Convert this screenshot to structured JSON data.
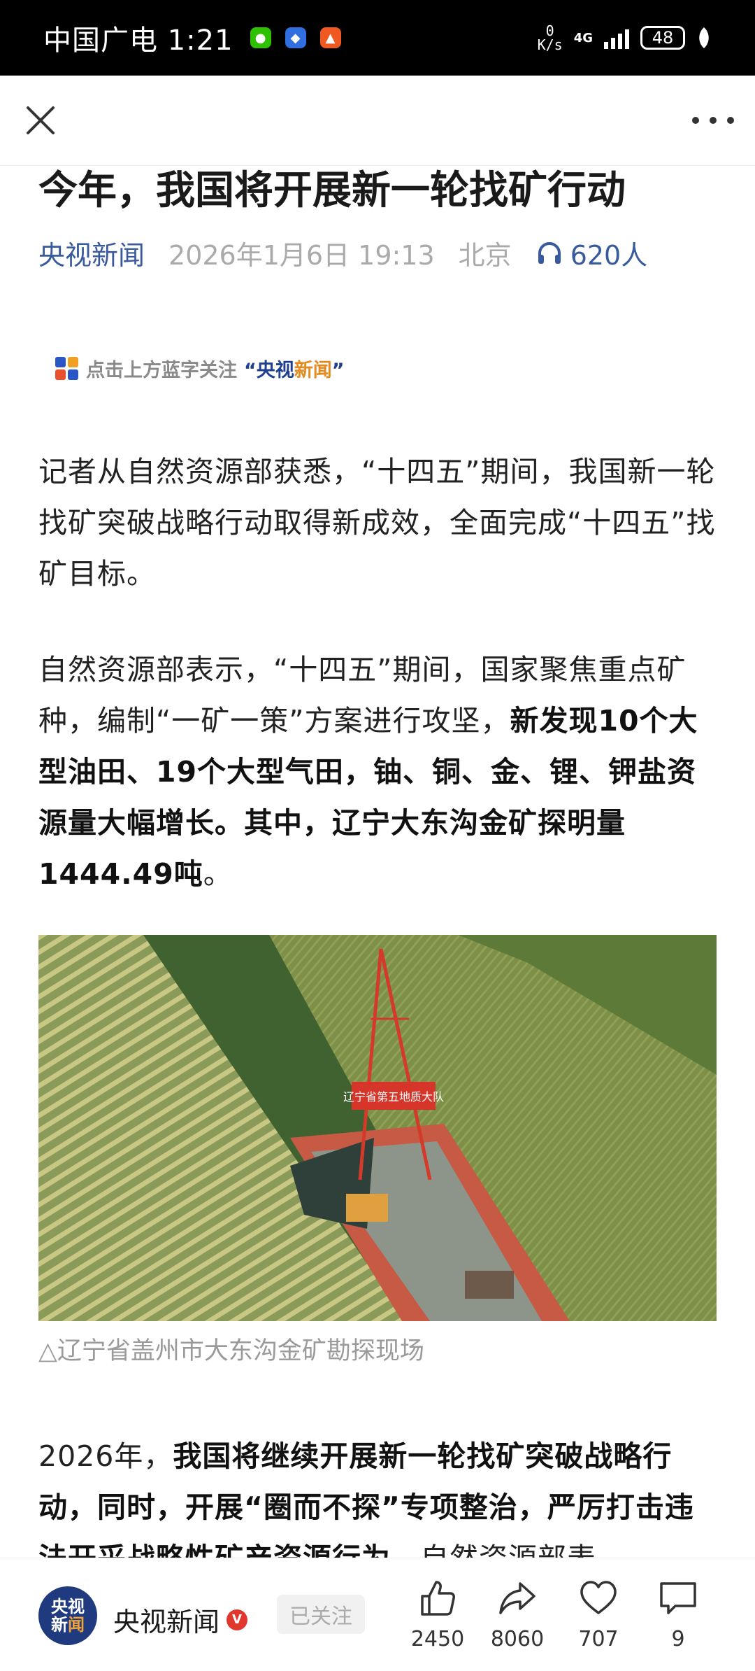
{
  "status_bar": {
    "carrier_time": "中国广电 1:21",
    "net_speed_value": "0",
    "net_speed_unit": "K/s",
    "network": "4G",
    "battery": "48",
    "apps": [
      "wechat-icon",
      "app-blue-icon",
      "app-orange-icon"
    ]
  },
  "nav": {
    "close_icon": "close-icon",
    "more_icon": "more-icon"
  },
  "article": {
    "title": "今年，我国将开展新一轮找矿行动",
    "source": "央视新闻",
    "datetime": "2026年1月6日 19:13",
    "location": "北京",
    "listeners": "620人",
    "follow_banner": {
      "text": "点击上方蓝字关注",
      "quote_open": "“",
      "brand_part1": "央视",
      "brand_part2": "新闻",
      "quote_close": "”"
    },
    "para1": "记者从自然资源部获悉，“十四五”期间，我国新一轮找矿突破战略行动取得新成效，全面完成“十四五”找矿目标。",
    "para2_normal": "自然资源部表示，“十四五”期间，国家聚焦重点矿种，编制“一矿一策”方案进行攻坚，",
    "para2_bold": "新发现10个大型油田、19个大型气田，铀、铜、金、锂、钾盐资源量大幅增长。其中，辽宁大东沟金矿探明量1444.49吨",
    "para2_end": "。",
    "photo_sign": "辽宁省第五地质大队",
    "caption": "△辽宁省盖州市大东沟金矿勘探现场",
    "para3_normal": "2026年，",
    "para3_bold": "我国将继续开展新一轮找矿突破战略行动，同时，开展“圈而不探”专项整治，严厉打击违法开采战略性矿产资源行为",
    "para3_tail": "。自然资源部表"
  },
  "bottom_bar": {
    "avatar_line1": "央视",
    "avatar_line2a": "新",
    "avatar_line2b": "闻",
    "account_name": "央视新闻",
    "verified_badge": "V",
    "follow_label": "已关注",
    "likes": "2450",
    "shares": "8060",
    "favorites": "707",
    "comments": "9"
  }
}
